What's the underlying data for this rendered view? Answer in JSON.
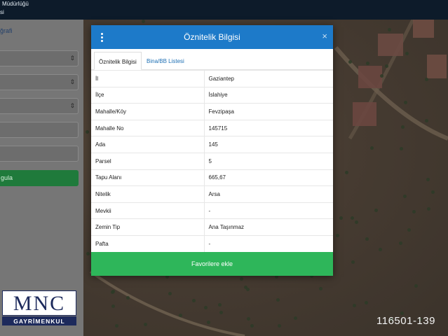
{
  "header": {
    "line1": "Müdürlüğü",
    "line2": "si"
  },
  "sidebar": {
    "link_label": "ğrafi",
    "query_label": "gula"
  },
  "modal": {
    "title": "Öznitelik Bilgisi",
    "close_label": "×",
    "tabs": [
      {
        "label": "Öznitelik Bilgisi",
        "active": true
      },
      {
        "label": "Bina/BB Listesi",
        "active": false
      }
    ],
    "rows": [
      {
        "key": "İl",
        "value": "Gaziantep"
      },
      {
        "key": "İlçe",
        "value": "İslahiye"
      },
      {
        "key": "Mahalle/Köy",
        "value": "Fevzipaşa"
      },
      {
        "key": "Mahalle No",
        "value": "145715"
      },
      {
        "key": "Ada",
        "value": "145"
      },
      {
        "key": "Parsel",
        "value": "5"
      },
      {
        "key": "Tapu Alanı",
        "value": "665,67"
      },
      {
        "key": "Nitelik",
        "value": "Arsa"
      },
      {
        "key": "Mevkii",
        "value": "-"
      },
      {
        "key": "Zemin Tip",
        "value": "Ana Taşınmaz"
      },
      {
        "key": "Pafta",
        "value": "-"
      }
    ],
    "favorite_button": "Favorilere ekle"
  },
  "logo": {
    "name": "MNC",
    "subtitle": "GAYRİMENKUL"
  },
  "listing_id": "116501-139",
  "icons": {
    "menu": "vertical-dots-icon",
    "close": "close-icon",
    "dropdown": "dropdown-caret-icon"
  },
  "colors": {
    "header": "#1d7ac9",
    "favorite": "#2eb65a",
    "query": "#1f7a3b",
    "topbar": "#0d1b2a"
  }
}
